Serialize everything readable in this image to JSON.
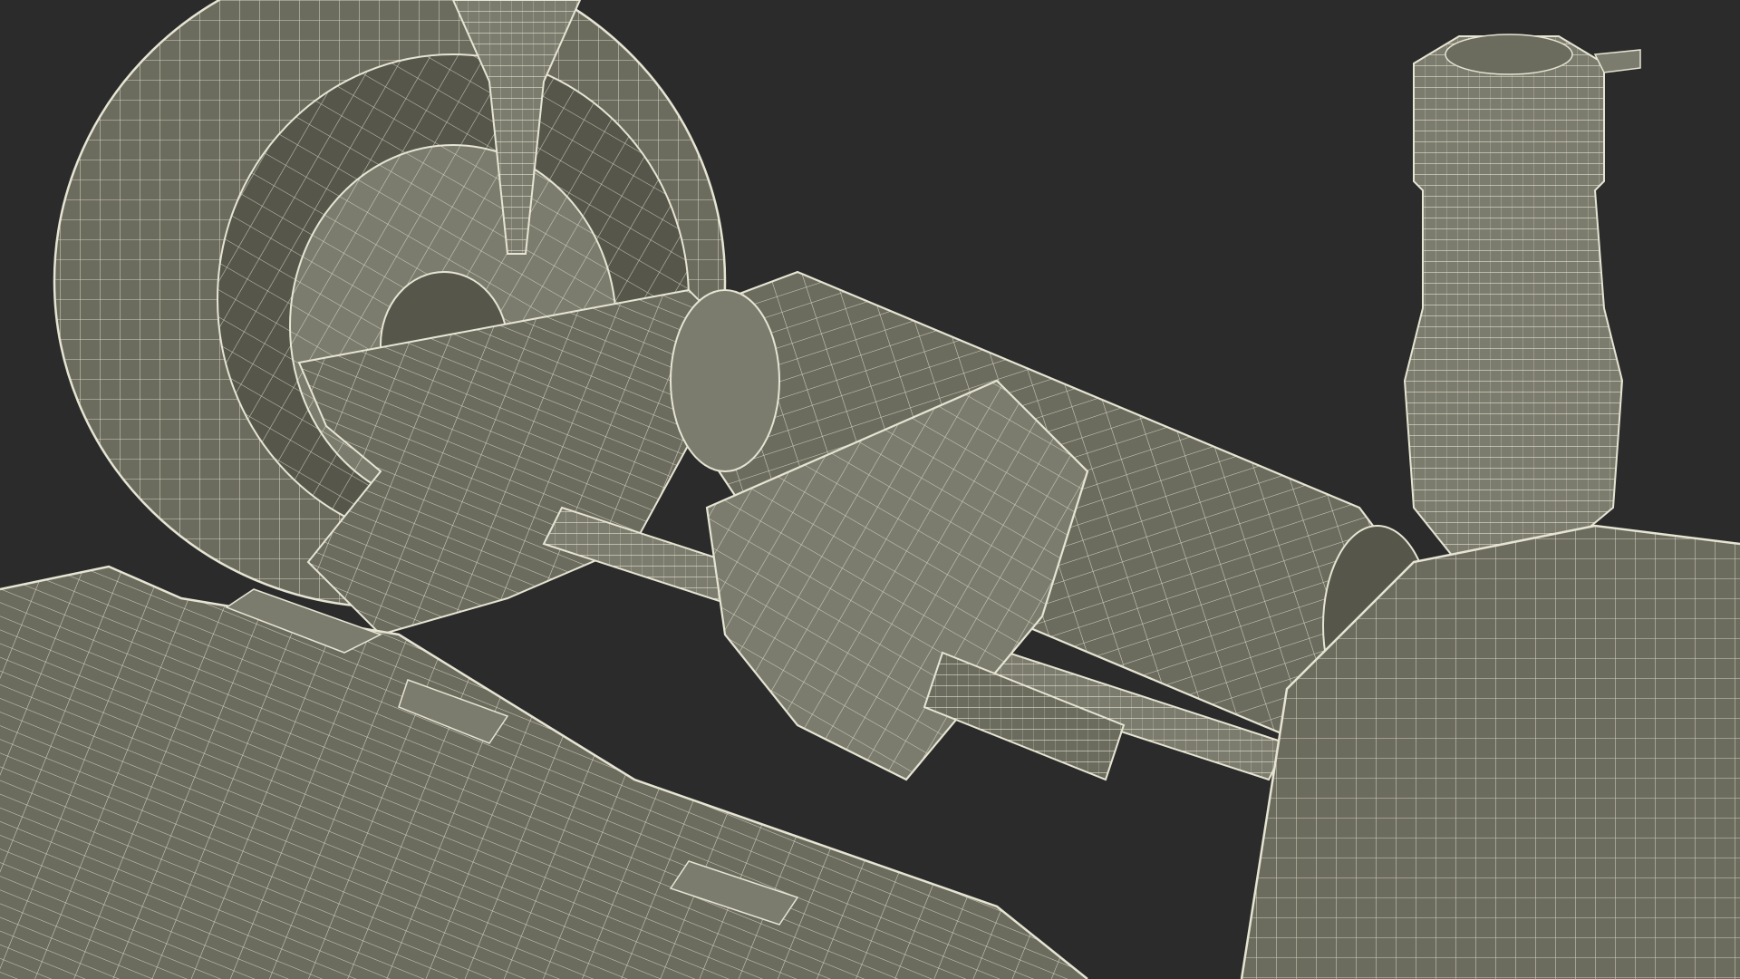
{
  "scene": {
    "background_color": "#2b2b2b",
    "mesh_fill_color": "#6b6b5e",
    "mesh_fill_dark": "#56564b",
    "mesh_fill_light": "#7c7c6e",
    "wire_color": "#e6e4d2",
    "objects": [
      "wheel-left",
      "wheel-hub-left",
      "suspension-arm-left",
      "strut-left",
      "electric-motor",
      "gearbox-housing",
      "drive-axle",
      "air-spring",
      "wheel-right",
      "battery-pack-floor"
    ]
  }
}
